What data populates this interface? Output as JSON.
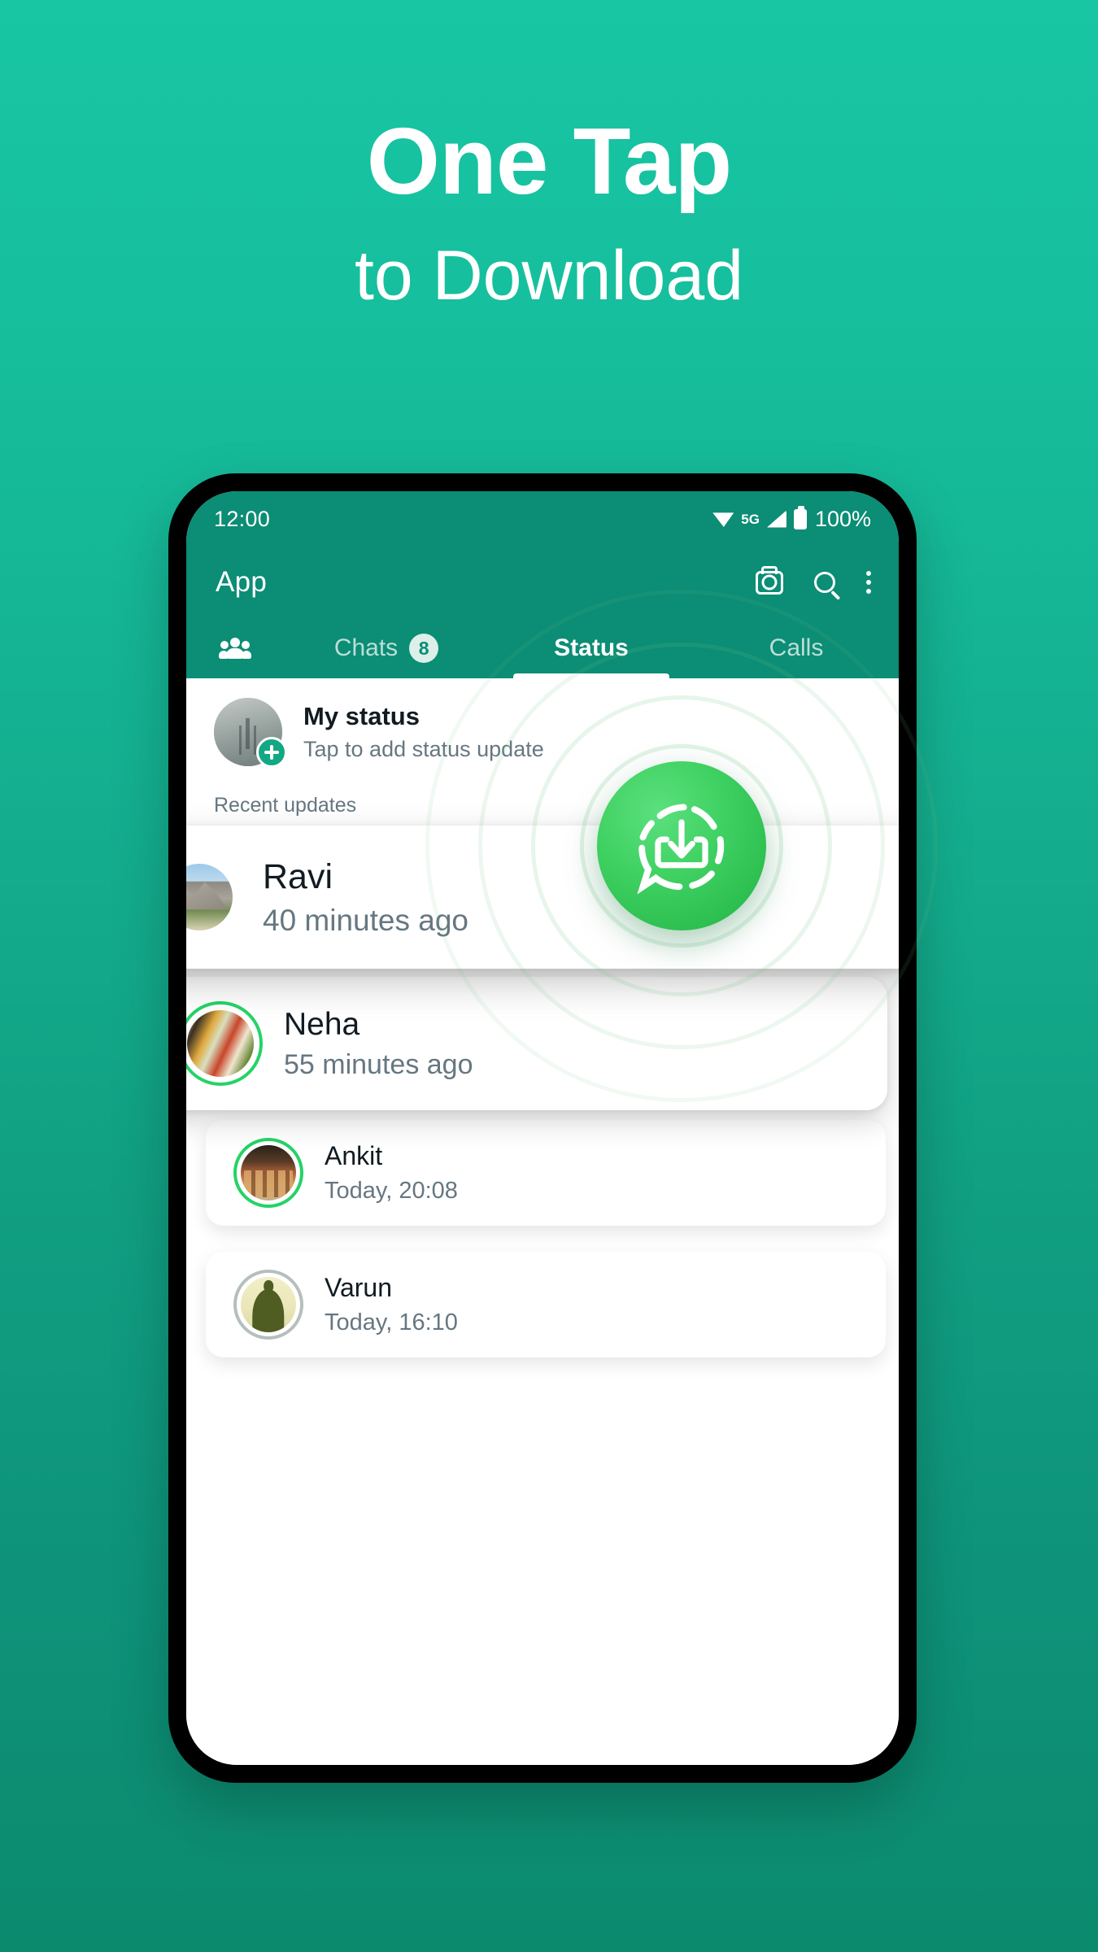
{
  "hero": {
    "title": "One Tap",
    "subtitle": "to Download"
  },
  "theme": {
    "bg_top": "#18C6A4",
    "bg_bottom": "#0C8A6E",
    "appbar": "#0C8D75",
    "accent_green": "#25D366",
    "fab_green": "#41D264"
  },
  "phone": {
    "status_bar": {
      "time": "12:00",
      "wifi_icon": "wifi-icon",
      "network": "5G",
      "signal_icon": "signal-bars-icon",
      "battery_icon": "battery-icon",
      "battery_text": "100%"
    },
    "app_bar": {
      "title": "App",
      "actions": [
        {
          "name": "camera-icon",
          "label": "Camera"
        },
        {
          "name": "search-icon",
          "label": "Search"
        },
        {
          "name": "overflow-menu-icon",
          "label": "More options"
        }
      ]
    },
    "tabs": {
      "community_icon": "community-icon",
      "items": [
        {
          "label": "Chats",
          "badge": "8",
          "active": false
        },
        {
          "label": "Status",
          "badge": "",
          "active": true
        },
        {
          "label": "Calls",
          "badge": "",
          "active": false
        }
      ]
    },
    "my_status": {
      "title": "My status",
      "subtitle": "Tap to add status update",
      "add_icon": "plus-icon",
      "avatar": "my-status-avatar"
    },
    "section_label": "Recent updates",
    "updates": [
      {
        "name": "Ravi",
        "time": "40 minutes ago",
        "ring": "unviewed"
      },
      {
        "name": "Neha",
        "time": "55 minutes ago",
        "ring": "unviewed"
      },
      {
        "name": "Ankit",
        "time": "Today, 20:08",
        "ring": "unviewed"
      },
      {
        "name": "Varun",
        "time": "Today, 16:10",
        "ring": "viewed"
      }
    ],
    "fab": {
      "name": "download-status-fab",
      "icon": "chat-bubble-download-icon"
    }
  }
}
